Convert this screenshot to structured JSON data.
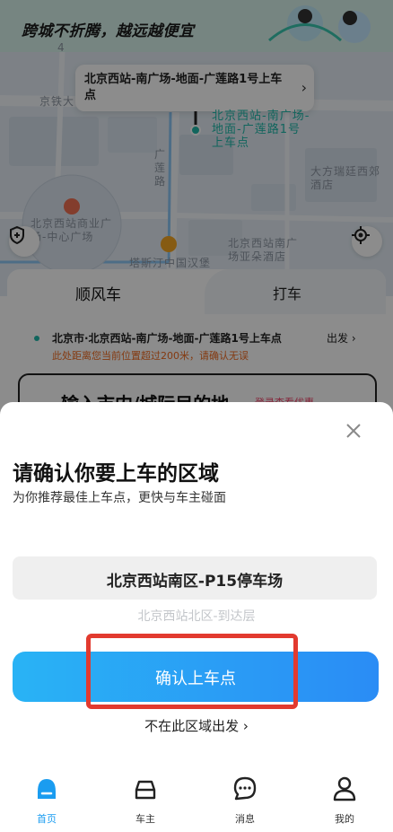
{
  "banner": {
    "title": "跨城不折腾，越远越便宜"
  },
  "map": {
    "pickup_callout": "北京西站-南广场-地面-广莲路1号上车点",
    "pin_label": "北京西站-南广场-地面-广莲路1号上车点",
    "labels": {
      "jingtie": "京铁大",
      "road_num": "4",
      "guanglian_road": "广莲路",
      "dafang": "大方瑞廷西郊酒店",
      "mall": "北京西站商业广场-中心广场",
      "tapu": "塔斯汀中国汉堡",
      "yaduo": "北京西站南广场亚朵酒店"
    }
  },
  "tabs": {
    "shunfeng": "顺风车",
    "daiche": "打车"
  },
  "start": {
    "address": "北京市·北京西站-南广场-地面-广莲路1号上车点",
    "depart": "出发",
    "warning": "此处距离您当前位置超过200米，请确认无误"
  },
  "destination": {
    "placeholder": "输入市内/城际目的地",
    "promo": "登录查看优惠"
  },
  "sheet": {
    "title": "请确认你要上车的区域",
    "subtitle": "为你推荐最佳上车点，更快与车主碰面",
    "zone_selected": "北京西站南区-P15停车场",
    "zone_other": "北京西站北区-到达层",
    "confirm_label": "确认上车点",
    "not_here_label": "不在此区域出发"
  },
  "nav": {
    "home": "首页",
    "driver": "车主",
    "messages": "消息",
    "mine": "我的"
  },
  "colors": {
    "accent": "#1a9cf0",
    "teal": "#1fb9a9",
    "warning": "#f06a1f",
    "highlight": "#e23a2f"
  }
}
